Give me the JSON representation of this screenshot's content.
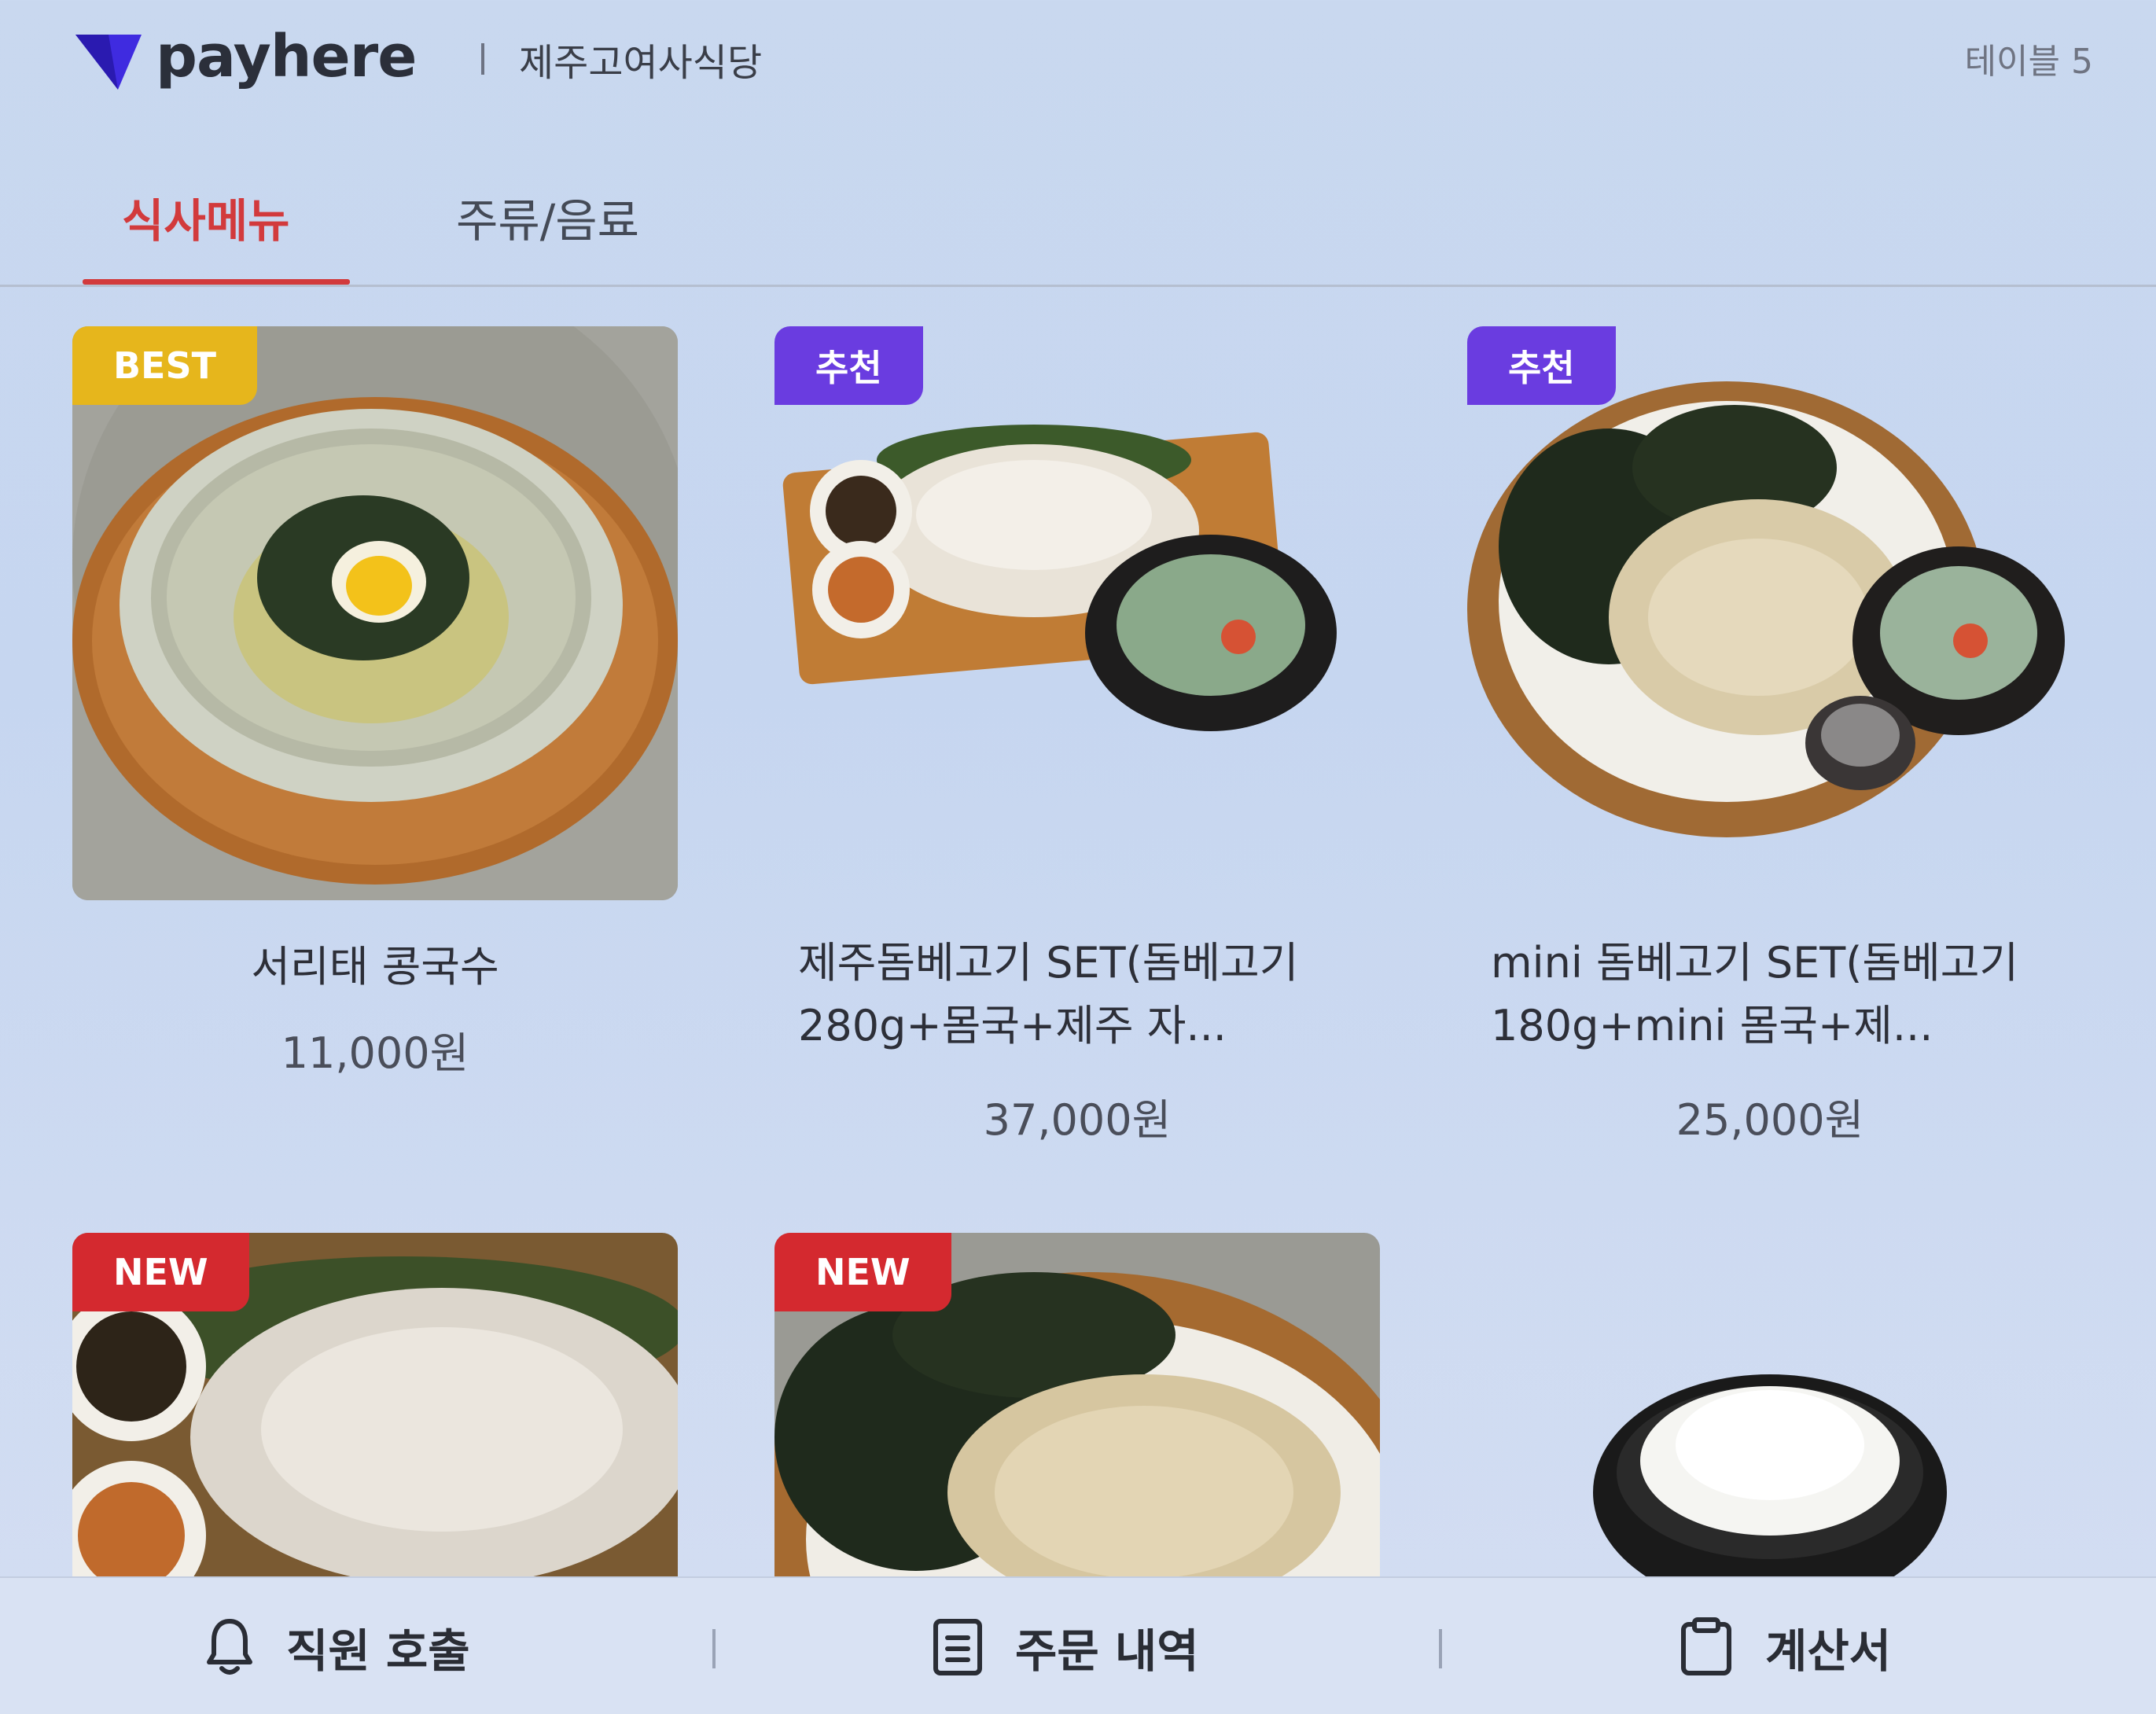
{
  "header": {
    "brand": "payhere",
    "store_name": "제주고여사식당",
    "table_label": "테이블 5"
  },
  "tabs": [
    {
      "label": "식사메뉴",
      "active": true
    },
    {
      "label": "주류/음료",
      "active": false
    }
  ],
  "menu": [
    {
      "badge": "BEST",
      "badge_color": "#e6b61c",
      "name": "서리태 콩국수",
      "price": "11,000원"
    },
    {
      "badge": "추천",
      "badge_color": "#6a3ce0",
      "name": "제주돔베고기 SET(돔베고기 280g+몸국+제주 자...",
      "price": "37,000원"
    },
    {
      "badge": "추천",
      "badge_color": "#6a3ce0",
      "name": "mini 돔베고기 SET(돔베고기 180g+mini 몸국+제...",
      "price": "25,000원"
    },
    {
      "badge": "NEW",
      "badge_color": "#d4292f"
    },
    {
      "badge": "NEW",
      "badge_color": "#d4292f"
    },
    {}
  ],
  "bottom_bar": {
    "call_staff": "직원 호출",
    "order_history": "주문 내역",
    "bill": "계산서"
  },
  "colors": {
    "accent": "#d23a3c",
    "brand_logo": "#3f2be0"
  }
}
